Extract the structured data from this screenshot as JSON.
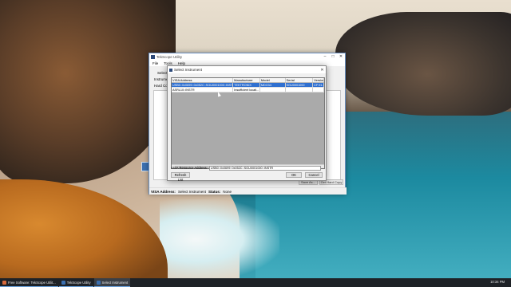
{
  "app": {
    "title": "TekScope Utility",
    "menu": [
      "File",
      "Tools",
      "Help"
    ],
    "side_select_label": "Select",
    "instrument_label": "Instrument",
    "hard_copy_label": "Hard Copy",
    "bottom_buttons": [
      "Save As...",
      "Get Hard Copy"
    ],
    "status": {
      "visa_label": "VISA Address:",
      "visa_value": "Select Instrument",
      "status_label": "Status:",
      "status_value": "None"
    }
  },
  "dialog": {
    "title": "Select Instrument",
    "columns": [
      "VISA Address",
      "Manufacturer",
      "Model",
      "Serial",
      "Version"
    ],
    "rows": [
      [
        "USB0::0x0699::0x052C::SGU0001000::INSTR",
        "TEKTRONIX",
        "MDO34",
        "SGU0001000",
        "CF:91.1"
      ],
      [
        "ASRL10::INSTR",
        "Insufficient locati...",
        "",
        "",
        ""
      ]
    ],
    "selected_row": 0,
    "resource_label": "VISA Resource Address:",
    "resource_value": "USB0::0x0699::0x052C::SGU0001000::INSTR",
    "refresh_label": "Refresh List",
    "ok_label": "OK",
    "cancel_label": "Cancel"
  },
  "taskbar": {
    "items": [
      {
        "label": "Free Software: TekScope Utilit...",
        "icon": "browser-icon"
      },
      {
        "label": "TekScope Utility",
        "icon": "app-icon"
      },
      {
        "label": "Select Instrument",
        "icon": "app-icon"
      }
    ],
    "time": "10:34 PM"
  }
}
